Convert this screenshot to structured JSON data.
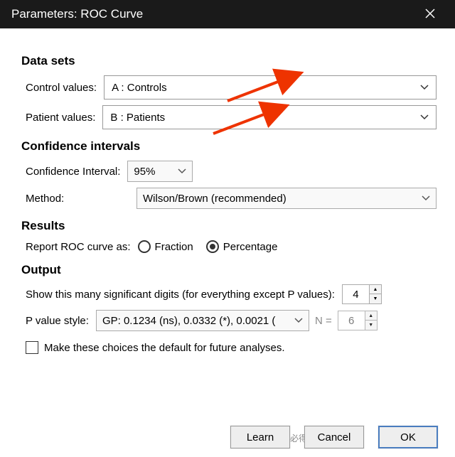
{
  "title": "Parameters: ROC Curve",
  "sections": {
    "datasets": {
      "title": "Data sets",
      "control_label": "Control values:",
      "control_value": "A : Controls",
      "patient_label": "Patient values:",
      "patient_value": "B : Patients"
    },
    "ci": {
      "title": "Confidence intervals",
      "ci_label": "Confidence Interval:",
      "ci_value": "95%",
      "method_label": "Method:",
      "method_value": "Wilson/Brown (recommended)"
    },
    "results": {
      "title": "Results",
      "report_label": "Report ROC curve as:",
      "fraction": "Fraction",
      "percentage": "Percentage"
    },
    "output": {
      "title": "Output",
      "sigdig_label": "Show this many significant digits (for everything except P values):",
      "sigdig_value": "4",
      "pstyle_label": "P value style:",
      "pstyle_value": "GP: 0.1234 (ns), 0.0332 (*), 0.0021 (",
      "n_eq": "N =",
      "n_value": "6",
      "default_label": "Make these choices the default for future analyses."
    }
  },
  "buttons": {
    "learn": "Learn",
    "cancel": "Cancel",
    "ok": "OK"
  },
  "watermark": "头条 @投必得论文编译"
}
